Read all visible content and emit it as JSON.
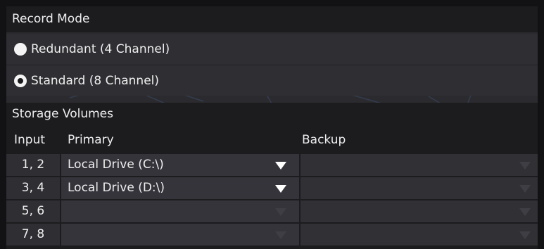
{
  "record_mode": {
    "title": "Record Mode",
    "options": [
      {
        "label": "Redundant (4 Channel)",
        "selected": false
      },
      {
        "label": "Standard (8 Channel)",
        "selected": true
      }
    ]
  },
  "storage": {
    "title": "Storage Volumes",
    "columns": {
      "input": "Input",
      "primary": "Primary",
      "backup": "Backup"
    },
    "rows": [
      {
        "input": "1, 2",
        "primary": "Local Drive (C:\\)",
        "backup": ""
      },
      {
        "input": "3, 4",
        "primary": "Local Drive (D:\\)",
        "backup": ""
      },
      {
        "input": "5, 6",
        "primary": "",
        "backup": ""
      },
      {
        "input": "7, 8",
        "primary": "",
        "backup": ""
      }
    ]
  },
  "icons": {
    "radio": "radio-button-icon",
    "dropdown": "chevron-down-icon"
  },
  "colors": {
    "panel_bg": "#2b2b2f",
    "header_bg": "#1c1c1f",
    "text": "#eeeeef",
    "caret_active": "#ffffff",
    "caret_disabled": "#3e3e44"
  }
}
